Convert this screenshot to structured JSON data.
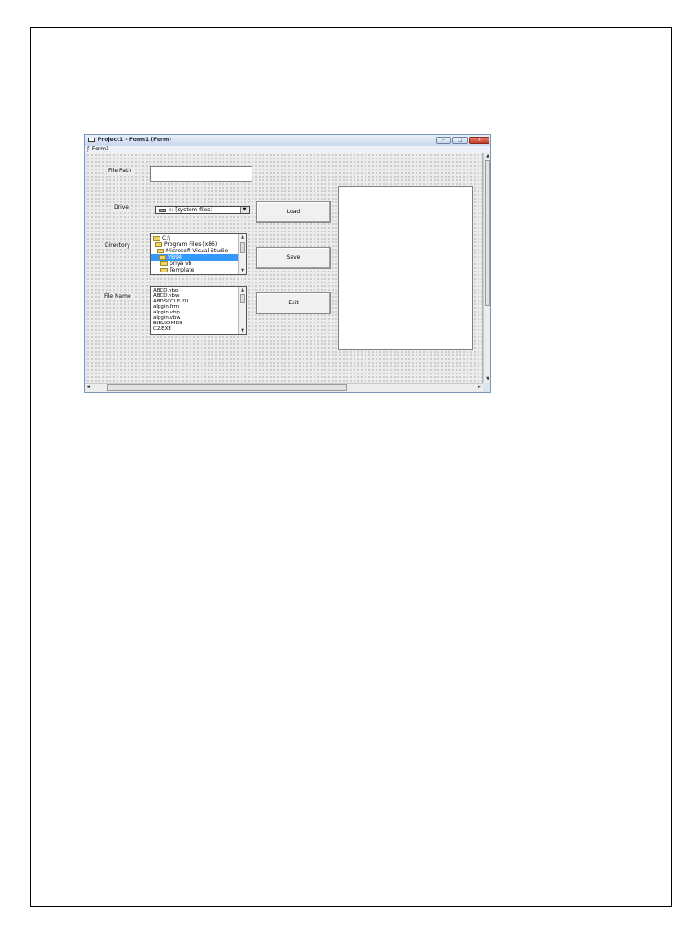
{
  "window": {
    "title": "Project1 - Form1 (Form)",
    "form_caption": "Form1",
    "controls": {
      "minimize": "–",
      "maximize": "□",
      "close": "x"
    }
  },
  "form": {
    "labels": {
      "file_path": "File Path",
      "drive": "Drive",
      "directory": "Directory",
      "file_name": "File Name"
    },
    "file_path_value": "",
    "drive_value": "c: [system files]",
    "directory_items": [
      {
        "label": "C:\\",
        "selected": false
      },
      {
        "label": "Program Files (x86)",
        "selected": false
      },
      {
        "label": "Microsoft Visual Studio",
        "selected": false
      },
      {
        "label": "VB98",
        "selected": true
      },
      {
        "label": "priya vb",
        "selected": false
      },
      {
        "label": "Template",
        "selected": false
      }
    ],
    "file_items": [
      "ABCD.vbp",
      "ABCD.vbw",
      "ABDSCCUS.DLL",
      "alpgin.frm",
      "alpgin.vbp",
      "alpgin.vbw",
      "BIBLIO.MDB",
      "C2.EXE"
    ],
    "buttons": {
      "load": "Load",
      "save": "Save",
      "exit": "Exit"
    }
  },
  "icons": {
    "window_icon": "form-window-icon",
    "drive_icon": "hard-drive-icon",
    "folder_icon": "folder-icon",
    "dropdown_icon": "chevron-down-icon"
  },
  "colors": {
    "selection": "#3399ff",
    "title_gradient_top": "#e9f0f9",
    "close_button": "#c23a24",
    "form_background": "#ececec"
  }
}
